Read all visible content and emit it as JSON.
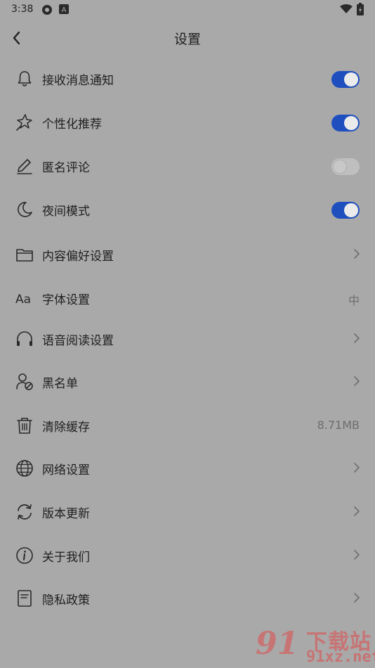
{
  "status_bar": {
    "time": "3:38",
    "icons": [
      "settings-gear-icon",
      "text-a-icon",
      "wifi-icon",
      "battery-charging-icon"
    ]
  },
  "header": {
    "title": "设置",
    "back_icon": "back-arrow-icon"
  },
  "settings": [
    {
      "id": "notifications",
      "icon": "bell-icon",
      "label": "接收消息通知",
      "control": "toggle",
      "on": true
    },
    {
      "id": "personalized",
      "icon": "sparkle-icon",
      "label": "个性化推荐",
      "control": "toggle",
      "on": true
    },
    {
      "id": "anonymous-comment",
      "icon": "pencil-icon",
      "label": "匿名评论",
      "control": "toggle",
      "on": false
    },
    {
      "id": "night-mode",
      "icon": "moon-icon",
      "label": "夜间模式",
      "control": "toggle",
      "on": true
    },
    {
      "id": "content-preference",
      "icon": "folder-icon",
      "label": "内容偏好设置",
      "control": "chevron"
    },
    {
      "id": "font",
      "icon": "font-aa-icon",
      "label": "字体设置",
      "control": "value",
      "value": "中"
    },
    {
      "id": "voice-reading",
      "icon": "headphones-icon",
      "label": "语音阅读设置",
      "control": "chevron"
    },
    {
      "id": "blacklist",
      "icon": "user-block-icon",
      "label": "黑名单",
      "control": "chevron"
    },
    {
      "id": "clear-cache",
      "icon": "trash-icon",
      "label": "清除缓存",
      "control": "value",
      "value": "8.71MB"
    },
    {
      "id": "network",
      "icon": "globe-icon",
      "label": "网络设置",
      "control": "chevron"
    },
    {
      "id": "update",
      "icon": "refresh-icon",
      "label": "版本更新",
      "control": "chevron"
    },
    {
      "id": "about",
      "icon": "info-icon",
      "label": "关于我们",
      "control": "chevron"
    },
    {
      "id": "privacy",
      "icon": "document-icon",
      "label": "隐私政策",
      "control": "chevron"
    }
  ],
  "watermark": {
    "big": "91",
    "cn": "下载站",
    "en": "91xz.net"
  },
  "colors": {
    "background": "#a9a9a9",
    "toggle_on": "#1f4fbf",
    "toggle_off": "#bfbfbf",
    "text": "#1f1f1f",
    "secondary_text": "#6d6d6d"
  }
}
